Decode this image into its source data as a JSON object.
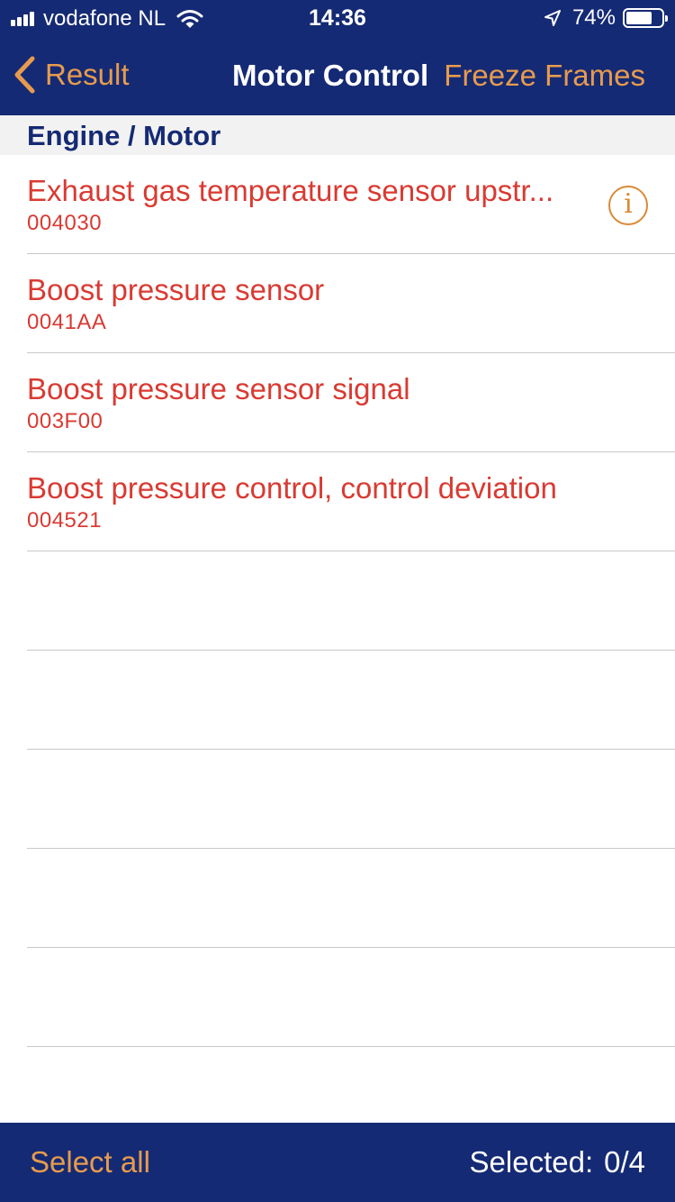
{
  "status_bar": {
    "carrier": "vodafone NL",
    "time": "14:36",
    "battery_percent": "74%",
    "battery_level": 0.74,
    "icons": [
      "signal-bars-icon",
      "wifi-icon",
      "location-arrow-icon",
      "battery-icon"
    ]
  },
  "nav": {
    "back_label": "Result",
    "title": "Motor Control",
    "action_label": "Freeze Frames"
  },
  "section": {
    "title": "Engine / Motor"
  },
  "faults": [
    {
      "name": "Exhaust gas temperature sensor upstr...",
      "code": "004030",
      "has_info": true
    },
    {
      "name": "Boost pressure sensor",
      "code": "0041AA",
      "has_info": false
    },
    {
      "name": "Boost pressure sensor signal",
      "code": "003F00",
      "has_info": false
    },
    {
      "name": "Boost pressure control, control deviation",
      "code": "004521",
      "has_info": false
    }
  ],
  "info_icon_glyph": "i",
  "toolbar": {
    "select_all_label": "Select all",
    "selected_label": "Selected:",
    "selected_count": "0/4"
  },
  "colors": {
    "bar_background": "#152a74",
    "accent": "#e79b4e",
    "fault_text": "#d93a32",
    "section_text": "#152a74",
    "section_background": "#f2f2f2"
  }
}
